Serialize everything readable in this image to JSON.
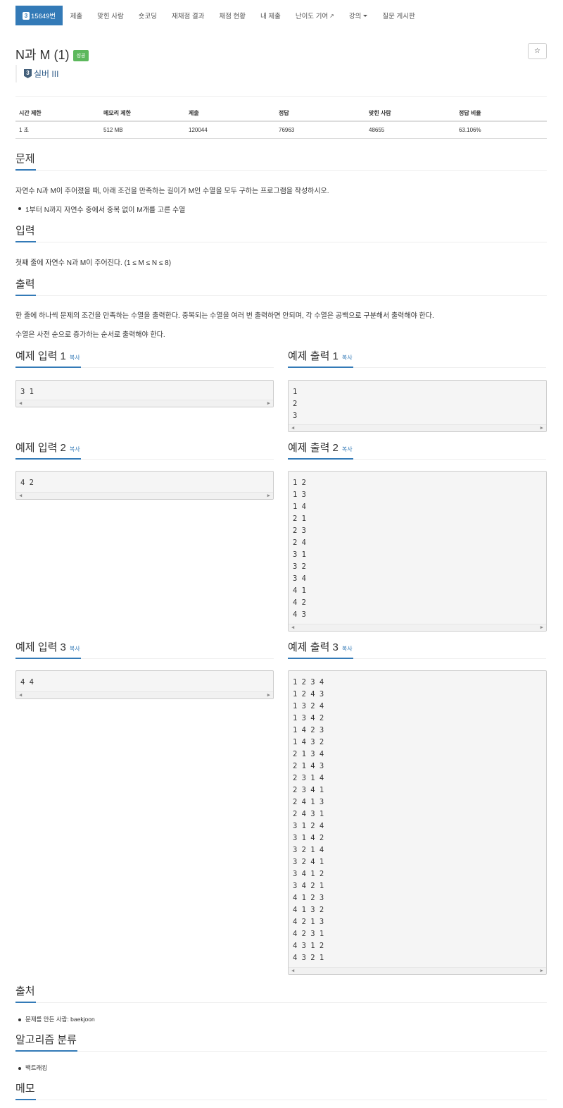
{
  "nav": {
    "active": {
      "tier_badge": "3",
      "label": "15649번"
    },
    "items": [
      "제출",
      "맞힌 사람",
      "숏코딩",
      "재채점 결과",
      "채점 현황",
      "내 제출",
      "난이도 기여",
      "강의",
      "질문 게시판"
    ]
  },
  "problem": {
    "title": "N과 M (1)",
    "status_badge": "성공",
    "star_icon": "☆",
    "tier_badge": "3",
    "tier_label": "실버 III"
  },
  "info_table": {
    "headers": [
      "시간 제한",
      "메모리 제한",
      "제출",
      "정답",
      "맞힌 사람",
      "정답 비율"
    ],
    "values": [
      "1 초",
      "512 MB",
      "120044",
      "76963",
      "48655",
      "63.106%"
    ]
  },
  "sections": {
    "description": {
      "heading": "문제",
      "text": "자연수 N과 M이 주어졌을 때, 아래 조건을 만족하는 길이가 M인 수열을 모두 구하는 프로그램을 작성하시오.",
      "bullet": "1부터 N까지 자연수 중에서 중복 없이 M개를 고른 수열"
    },
    "input": {
      "heading": "입력",
      "text": "첫째 줄에 자연수 N과 M이 주어진다. (1 ≤ M ≤ N ≤ 8)"
    },
    "output": {
      "heading": "출력",
      "text1": "한 줄에 하나씩 문제의 조건을 만족하는 수열을 출력한다. 중복되는 수열을 여러 번 출력하면 안되며, 각 수열은 공백으로 구분해서 출력해야 한다.",
      "text2": "수열은 사전 순으로 증가하는 순서로 출력해야 한다."
    },
    "source": {
      "heading": "출처",
      "bullet": "문제를 만든 사람: baekjoon"
    },
    "algorithm": {
      "heading": "알고리즘 분류",
      "bullet": "백트래킹"
    },
    "memo": {
      "heading": "메모"
    }
  },
  "copy_label": "복사",
  "examples": [
    {
      "input_heading": "예제 입력 1",
      "output_heading": "예제 출력 1",
      "input": [
        "3 1"
      ],
      "output": [
        "1",
        "2",
        "3"
      ]
    },
    {
      "input_heading": "예제 입력 2",
      "output_heading": "예제 출력 2",
      "input": [
        "4 2"
      ],
      "output": [
        "1 2",
        "1 3",
        "1 4",
        "2 1",
        "2 3",
        "2 4",
        "3 1",
        "3 2",
        "3 4",
        "4 1",
        "4 2",
        "4 3"
      ]
    },
    {
      "input_heading": "예제 입력 3",
      "output_heading": "예제 출력 3",
      "input": [
        "4 4"
      ],
      "output": [
        "1 2 3 4",
        "1 2 4 3",
        "1 3 2 4",
        "1 3 4 2",
        "1 4 2 3",
        "1 4 3 2",
        "2 1 3 4",
        "2 1 4 3",
        "2 3 1 4",
        "2 3 4 1",
        "2 4 1 3",
        "2 4 3 1",
        "3 1 2 4",
        "3 1 4 2",
        "3 2 1 4",
        "3 2 4 1",
        "3 4 1 2",
        "3 4 2 1",
        "4 1 2 3",
        "4 1 3 2",
        "4 2 1 3",
        "4 2 3 1",
        "4 3 1 2",
        "4 3 2 1"
      ]
    }
  ]
}
